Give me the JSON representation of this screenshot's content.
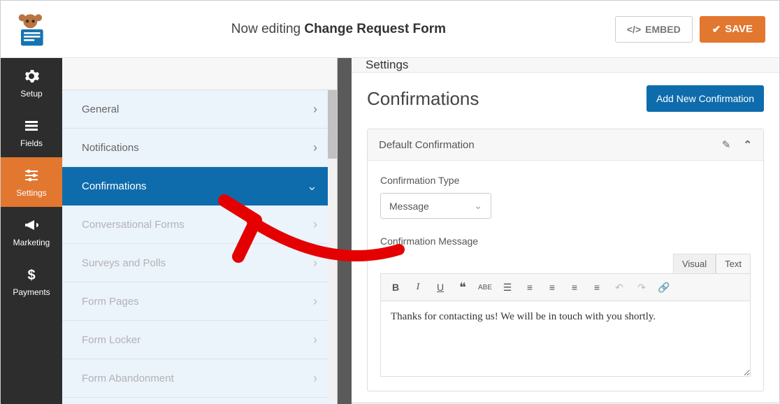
{
  "header": {
    "editing_prefix": "Now editing ",
    "form_name": "Change Request Form",
    "embed_label": "EMBED",
    "save_label": "SAVE"
  },
  "sidenav": {
    "items": [
      {
        "label": "Setup",
        "icon": "gear-icon"
      },
      {
        "label": "Fields",
        "icon": "list-icon"
      },
      {
        "label": "Settings",
        "icon": "sliders-icon",
        "active": true
      },
      {
        "label": "Marketing",
        "icon": "bullhorn-icon"
      },
      {
        "label": "Payments",
        "icon": "dollar-icon"
      }
    ]
  },
  "subpanel": {
    "items": [
      {
        "label": "General"
      },
      {
        "label": "Notifications"
      },
      {
        "label": "Confirmations",
        "active": true
      },
      {
        "label": "Conversational Forms",
        "disabled": true
      },
      {
        "label": "Surveys and Polls",
        "disabled": true
      },
      {
        "label": "Form Pages",
        "disabled": true
      },
      {
        "label": "Form Locker",
        "disabled": true
      },
      {
        "label": "Form Abandonment",
        "disabled": true
      }
    ]
  },
  "main": {
    "header": "Settings",
    "section_title": "Confirmations",
    "add_new_label": "Add New Confirmation",
    "confirmation": {
      "title": "Default Confirmation",
      "type_label": "Confirmation Type",
      "type_value": "Message",
      "message_label": "Confirmation Message",
      "tabs": {
        "visual": "Visual",
        "text": "Text"
      },
      "message_value": "Thanks for contacting us! We will be in touch with you shortly."
    }
  }
}
